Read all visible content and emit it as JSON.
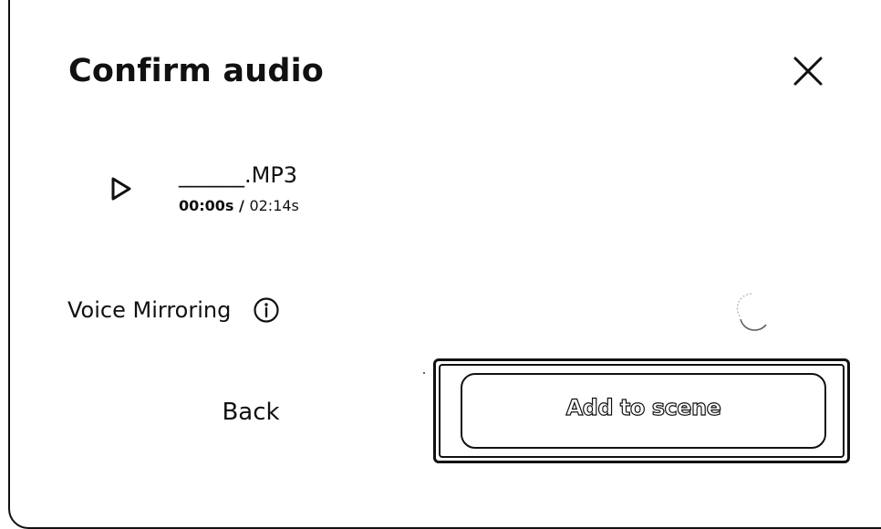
{
  "dialog": {
    "title": "Confirm audio",
    "close_icon": "close-icon"
  },
  "audio": {
    "play_icon": "play-icon",
    "file_name": "______.MP3",
    "current_time": "00:00s",
    "separator": " / ",
    "duration": "02:14s"
  },
  "voice_mirroring": {
    "label": "Voice Mirroring",
    "info_icon": "info-icon",
    "enabled": false
  },
  "actions": {
    "back_label": "Back",
    "add_label": "Add to scene"
  }
}
